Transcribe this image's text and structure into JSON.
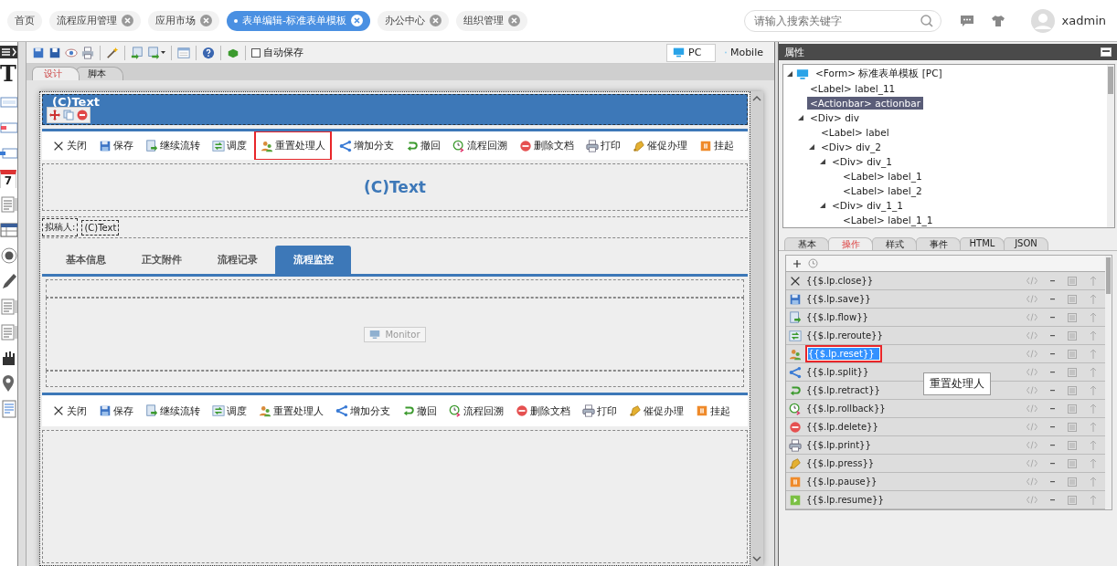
{
  "nav_tabs": [
    {
      "label": "首页",
      "closable": false,
      "selected": false
    },
    {
      "label": "流程应用管理",
      "closable": true,
      "selected": false
    },
    {
      "label": "应用市场",
      "closable": true,
      "selected": false
    },
    {
      "label": "表单编辑-标准表单模板",
      "closable": true,
      "selected": true
    },
    {
      "label": "办公中心",
      "closable": true,
      "selected": false
    },
    {
      "label": "组织管理",
      "closable": true,
      "selected": false
    }
  ],
  "search": {
    "placeholder": "请输入搜索关键字"
  },
  "user": {
    "name": "xadmin"
  },
  "palette": [
    {
      "kind": "glyph",
      "text": "T"
    },
    {
      "kind": "field"
    },
    {
      "kind": "field-red"
    },
    {
      "kind": "field-blue"
    },
    {
      "kind": "calendar",
      "text": "7"
    },
    {
      "kind": "lines"
    },
    {
      "kind": "grid"
    },
    {
      "kind": "radio"
    },
    {
      "kind": "pen"
    },
    {
      "kind": "lines"
    },
    {
      "kind": "lines"
    },
    {
      "kind": "hand"
    },
    {
      "kind": "pin"
    },
    {
      "kind": "doc"
    }
  ],
  "designer": {
    "autosave": {
      "label": "自动保存",
      "checked": false
    },
    "devices": [
      {
        "label": "PC",
        "kind": "pc",
        "selected": true
      },
      {
        "label": "Mobile",
        "kind": "mobile",
        "selected": false
      }
    ],
    "tabs": [
      {
        "label": "设计",
        "selected": true
      },
      {
        "label": "脚本",
        "selected": false
      }
    ],
    "form": {
      "header": "(C)Text",
      "actions": [
        {
          "kind": "close",
          "label": "关闭",
          "highlighted": false
        },
        {
          "kind": "save",
          "label": "保存",
          "highlighted": false
        },
        {
          "kind": "flow",
          "label": "继续流转",
          "highlighted": false
        },
        {
          "kind": "reroute",
          "label": "调度",
          "highlighted": false
        },
        {
          "kind": "reset",
          "label": "重置处理人",
          "highlighted": true
        },
        {
          "kind": "split",
          "label": "增加分支",
          "highlighted": false
        },
        {
          "kind": "retract",
          "label": "撤回",
          "highlighted": false
        },
        {
          "kind": "rollback",
          "label": "流程回溯",
          "highlighted": false
        },
        {
          "kind": "delete",
          "label": "删除文档",
          "highlighted": false
        },
        {
          "kind": "print",
          "label": "打印",
          "highlighted": false
        },
        {
          "kind": "press",
          "label": "催促办理",
          "highlighted": false
        },
        {
          "kind": "pause",
          "label": "挂起",
          "highlighted": false
        }
      ],
      "title": "(C)Text",
      "drafter": {
        "label": "拟稿人:",
        "value": "(C)Text"
      },
      "tabs": [
        {
          "label": "基本信息",
          "selected": false
        },
        {
          "label": "正文附件",
          "selected": false
        },
        {
          "label": "流程记录",
          "selected": false
        },
        {
          "label": "流程监控",
          "selected": true
        }
      ],
      "monitor_button": "Monitor",
      "actions_bottom": [
        {
          "kind": "close",
          "label": "关闭"
        },
        {
          "kind": "save",
          "label": "保存"
        },
        {
          "kind": "flow",
          "label": "继续流转"
        },
        {
          "kind": "reroute",
          "label": "调度"
        },
        {
          "kind": "reset",
          "label": "重置处理人"
        },
        {
          "kind": "split",
          "label": "增加分支"
        },
        {
          "kind": "retract",
          "label": "撤回"
        },
        {
          "kind": "rollback",
          "label": "流程回溯"
        },
        {
          "kind": "delete",
          "label": "删除文档"
        },
        {
          "kind": "print",
          "label": "打印"
        },
        {
          "kind": "press",
          "label": "催促办理"
        },
        {
          "kind": "pause",
          "label": "挂起"
        }
      ]
    }
  },
  "properties": {
    "title": "属性",
    "tree": [
      {
        "label": "<Form> 标准表单模板 [PC]",
        "kind": "form",
        "expanded": true,
        "selected": false,
        "children": [
          {
            "label": "<Label> label_11",
            "selected": false
          },
          {
            "label": "<Actionbar> actionbar",
            "selected": true
          },
          {
            "label": "<Div> div",
            "expanded": true,
            "selected": false,
            "children": [
              {
                "label": "<Label> label",
                "selected": false
              },
              {
                "label": "<Div> div_2",
                "expanded": true,
                "selected": false,
                "children": [
                  {
                    "label": "<Div> div_1",
                    "expanded": true,
                    "selected": false,
                    "children": [
                      {
                        "label": "<Label> label_1",
                        "selected": false
                      },
                      {
                        "label": "<Label> label_2",
                        "selected": false
                      }
                    ]
                  },
                  {
                    "label": "<Div> div_1_1",
                    "expanded": true,
                    "selected": false,
                    "children": [
                      {
                        "label": "<Label> label_1_1",
                        "selected": false
                      }
                    ]
                  }
                ]
              }
            ]
          }
        ]
      }
    ],
    "tabs": [
      {
        "label": "基本",
        "selected": false
      },
      {
        "label": "操作",
        "selected": true
      },
      {
        "label": "样式",
        "selected": false
      },
      {
        "label": "事件",
        "selected": false
      },
      {
        "label": "HTML",
        "selected": false
      },
      {
        "label": "JSON",
        "selected": false
      }
    ],
    "operations": [
      {
        "kind": "close",
        "text": "{{$.lp.close}}",
        "selected": false
      },
      {
        "kind": "save",
        "text": "{{$.lp.save}}",
        "selected": false
      },
      {
        "kind": "flow",
        "text": "{{$.lp.flow}}",
        "selected": false
      },
      {
        "kind": "reroute",
        "text": "{{$.lp.reroute}}",
        "selected": false
      },
      {
        "kind": "reset",
        "text": "{{$.lp.reset}}",
        "selected": true
      },
      {
        "kind": "split",
        "text": "{{$.lp.split}}",
        "selected": false
      },
      {
        "kind": "retract",
        "text": "{{$.lp.retract}}",
        "selected": false
      },
      {
        "kind": "rollback",
        "text": "{{$.lp.rollback}}",
        "selected": false
      },
      {
        "kind": "delete",
        "text": "{{$.lp.delete}}",
        "selected": false
      },
      {
        "kind": "print",
        "text": "{{$.lp.print}}",
        "selected": false
      },
      {
        "kind": "press",
        "text": "{{$.lp.press}}",
        "selected": false
      },
      {
        "kind": "pause",
        "text": "{{$.lp.pause}}",
        "selected": false
      },
      {
        "kind": "resume",
        "text": "{{$.lp.resume}}",
        "selected": false
      }
    ],
    "tooltip": "重置处理人"
  }
}
